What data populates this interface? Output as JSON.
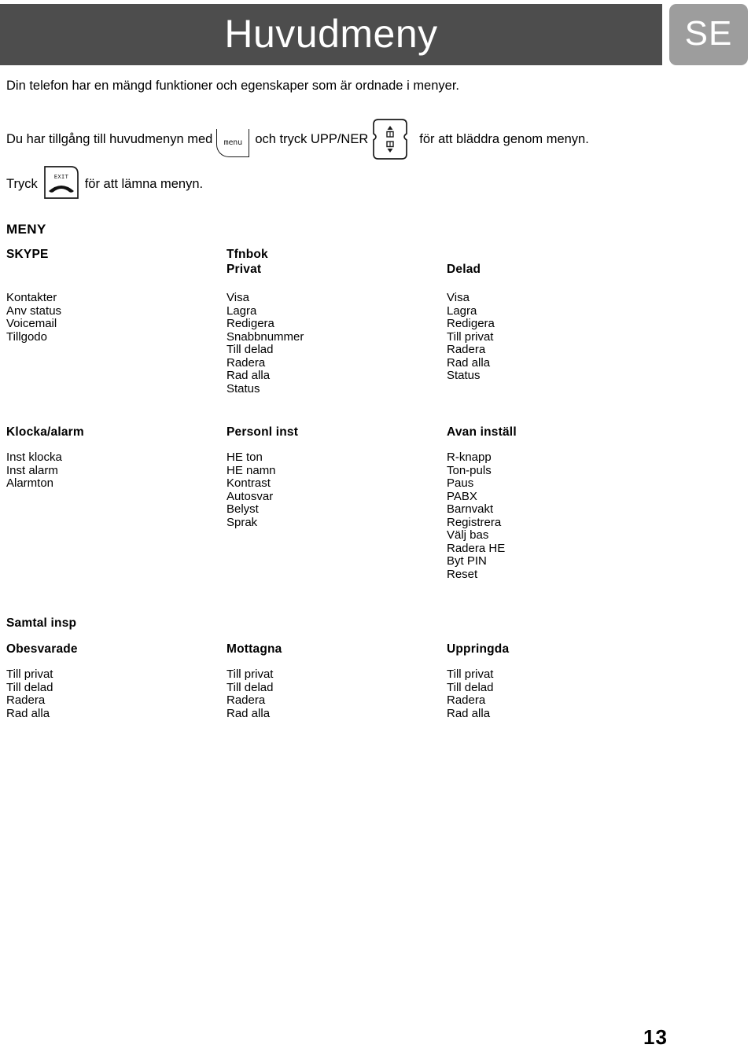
{
  "header": {
    "title": "Huvudmeny",
    "language_badge": "SE",
    "bar_color": "#4d4d4d",
    "badge_color": "#9d9d9d"
  },
  "intro": {
    "line1": "Din telefon har en mängd funktioner och egenskaper som är ordnade i menyer.",
    "line2_before": "Du har tillgång till huvudmenyn med",
    "line2_middle": "och tryck UPP/NER",
    "line2_after": "för att bläddra genom menyn.",
    "line3_before": "Tryck",
    "line3_after": "för att lämna menyn.",
    "menu_key_label": "menu",
    "exit_key_label": "EXIT"
  },
  "menu_heading": "MENY",
  "blocks": [
    {
      "title": "",
      "columns": [
        {
          "head1": "SKYPE",
          "head2": "",
          "items": [
            "Kontakter",
            "Anv status",
            "Voicemail",
            "Tillgodo"
          ]
        },
        {
          "head1": "Tfnbok",
          "head2": "Privat",
          "items": [
            "Visa",
            "Lagra",
            "Redigera",
            "Snabbnummer",
            "Till delad",
            "Radera",
            "Rad alla",
            "Status"
          ]
        },
        {
          "head1": "",
          "head2": "Delad",
          "items": [
            "Visa",
            "Lagra",
            "Redigera",
            "Till privat",
            "Radera",
            "Rad alla",
            "Status"
          ]
        }
      ]
    },
    {
      "title": "",
      "columns": [
        {
          "head1": "Klocka/alarm",
          "head2": "",
          "items": [
            "Inst klocka",
            "Inst alarm",
            "Alarmton"
          ]
        },
        {
          "head1": "Personl inst",
          "head2": "",
          "items": [
            "HE ton",
            "HE namn",
            "Kontrast",
            "Autosvar",
            "Belyst",
            "Sprak"
          ]
        },
        {
          "head1": "Avan inställ",
          "head2": "",
          "items": [
            "R-knapp",
            "Ton-puls",
            "Paus",
            "PABX",
            "Barnvakt",
            "Registrera",
            "Välj bas",
            "Radera HE",
            "Byt PIN",
            "Reset"
          ]
        }
      ]
    },
    {
      "title": "Samtal insp",
      "columns": [
        {
          "head1": "Obesvarade",
          "head2": "",
          "items": [
            "Till privat",
            "Till delad",
            "Radera",
            "Rad alla"
          ]
        },
        {
          "head1": "Mottagna",
          "head2": "",
          "items": [
            "Till privat",
            "Till delad",
            "Radera",
            "Rad alla"
          ]
        },
        {
          "head1": "Uppringda",
          "head2": "",
          "items": [
            "Till privat",
            "Till delad",
            "Radera",
            "Rad alla"
          ]
        }
      ]
    }
  ],
  "page_number": "13"
}
